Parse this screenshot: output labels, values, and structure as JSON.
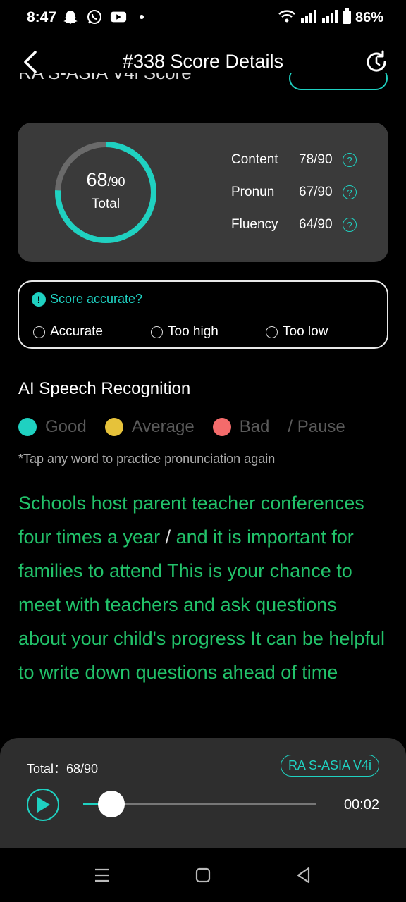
{
  "status_bar": {
    "time": "8:47",
    "battery": "86%",
    "icons": [
      "snapchat-icon",
      "whatsapp-icon",
      "youtube-icon",
      "wifi-icon",
      "signal-icon",
      "battery-icon"
    ]
  },
  "header": {
    "title": "#338 Score Details",
    "partial_label": "RA S-ASIA V4i Score"
  },
  "score": {
    "total_value": "68",
    "total_max": "/90",
    "total_label": "Total",
    "total_fraction": 0.756,
    "metrics": [
      {
        "label": "Content",
        "value": "78/90"
      },
      {
        "label": "Pronun",
        "value": "67/90"
      },
      {
        "label": "Fluency",
        "value": "64/90"
      }
    ]
  },
  "accuracy": {
    "question": "Score accurate?",
    "options": [
      "Accurate",
      "Too high",
      "Too low"
    ]
  },
  "recognition": {
    "title": "AI Speech Recognition",
    "legend": [
      {
        "label": "Good",
        "color": "#1fd1c1"
      },
      {
        "label": "Average",
        "color": "#e6c23a"
      },
      {
        "label": "Bad",
        "color": "#f46b6b"
      },
      {
        "label": "/ Pause",
        "color": ""
      }
    ],
    "hint": "*Tap any word to practice pronunciation again",
    "text_before": "Schools host parent teacher conferences four times a year",
    "pause": " / ",
    "text_after": "and it is important for families to attend This is your chance to meet with teachers and ask questions about your child's progress It can be helpful to write down questions ahead of time"
  },
  "player": {
    "total": "Total：68/90",
    "badge": "RA S-ASIA V4i",
    "time": "00:02",
    "progress": 0.12
  },
  "colors": {
    "accent": "#1fd1c1",
    "good_text": "#22c26a",
    "card_bg": "#3a3a3a"
  }
}
